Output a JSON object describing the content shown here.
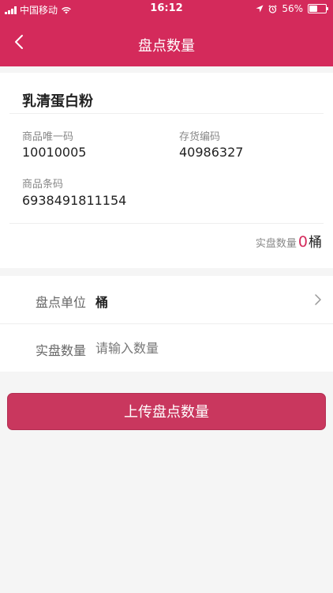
{
  "status_bar": {
    "carrier": "中国移动",
    "time": "16:12",
    "battery_percent": "56%",
    "battery_level": 0.56
  },
  "nav": {
    "title": "盘点数量",
    "back_icon": "chevron-left-icon"
  },
  "product": {
    "name": "乳清蛋白粉",
    "unique_code_label": "商品唯一码",
    "unique_code": "10010005",
    "inventory_code_label": "存货编码",
    "inventory_code": "40986327",
    "barcode_label": "商品条码",
    "barcode": "6938491811154",
    "actual_qty_label": "实盘数量",
    "actual_qty": "0",
    "actual_unit": "桶"
  },
  "form": {
    "unit_label": "盘点单位",
    "unit_value": "桶",
    "qty_label": "实盘数量",
    "qty_placeholder": "请输入数量",
    "qty_value": ""
  },
  "actions": {
    "upload_label": "上传盘点数量"
  },
  "colors": {
    "brand": "#d42a5b",
    "button": "#c9375e"
  }
}
